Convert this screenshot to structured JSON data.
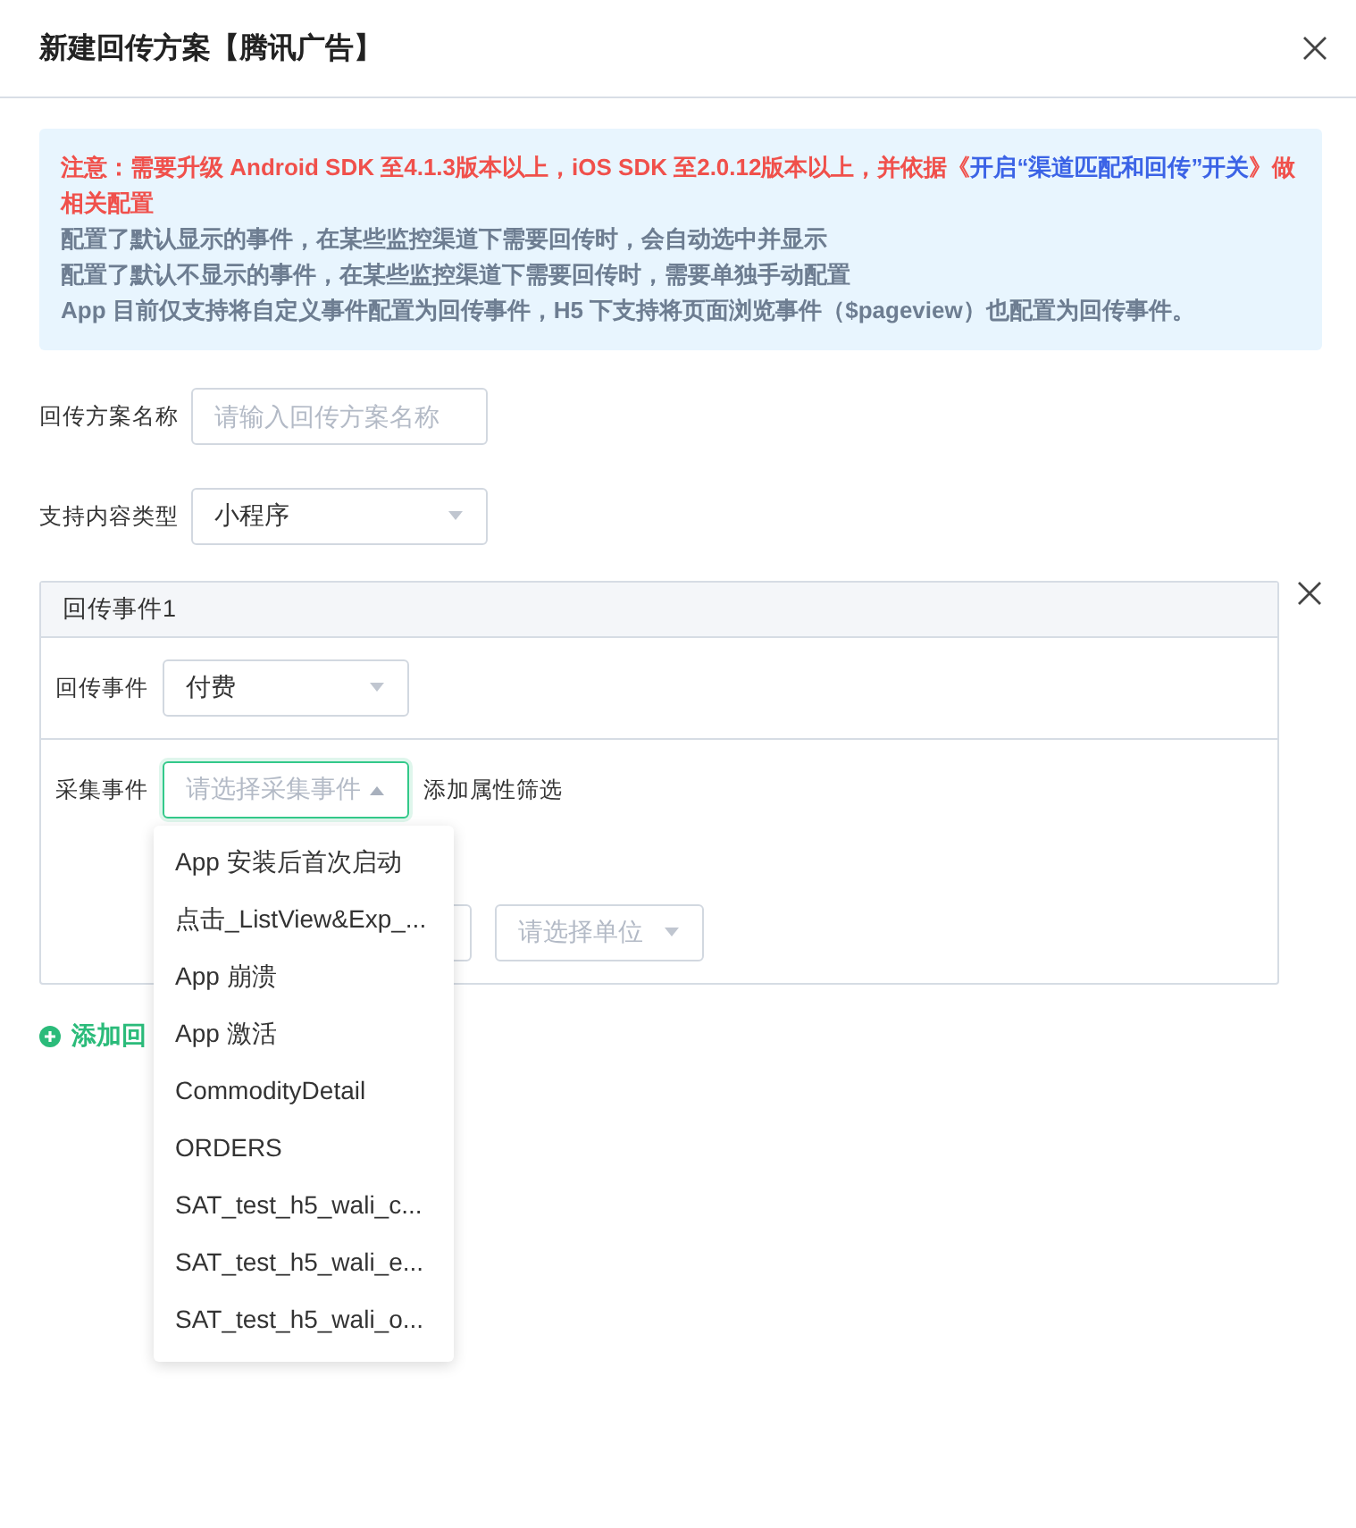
{
  "dialog": {
    "title": "新建回传方案【腾讯广告】"
  },
  "notice": {
    "warning": {
      "before": "注意：需要升级 Android SDK 至4.1.3版本以上，iOS SDK 至2.0.12版本以上，并依据《",
      "link": "开启“渠道匹配和回传”开关",
      "after": "》做相关配置"
    },
    "lines": [
      "配置了默认显示的事件，在某些监控渠道下需要回传时，会自动选中并显示",
      "配置了默认不显示的事件，在某些监控渠道下需要回传时，需要单独手动配置",
      "App 目前仅支持将自定义事件配置为回传事件，H5 下支持将页面浏览事件（$pageview）也配置为回传事件。"
    ]
  },
  "form": [
    {
      "kind": "input",
      "label": "回传方案名称",
      "placeholder": "请输入回传方案名称"
    },
    {
      "kind": "select",
      "label": "支持内容类型",
      "value": "小程序"
    }
  ],
  "event_card": {
    "title": "回传事件1",
    "return_event": {
      "label": "回传事件",
      "value": "付费"
    },
    "collect_event": {
      "label": "采集事件",
      "placeholder": "请选择采集事件",
      "expanded": true
    },
    "filter_link": "添加属性筛选",
    "unit_select": {
      "placeholder": "请选择单位"
    },
    "options": [
      "App 安装后首次启动",
      "点击_ListView&Exp_...",
      "App 崩溃",
      "App 激活",
      "CommodityDetail",
      "ORDERS",
      "SAT_test_h5_wali_c...",
      "SAT_test_h5_wali_e...",
      "SAT_test_h5_wali_o..."
    ]
  },
  "add_button": {
    "label": "添加回"
  }
}
